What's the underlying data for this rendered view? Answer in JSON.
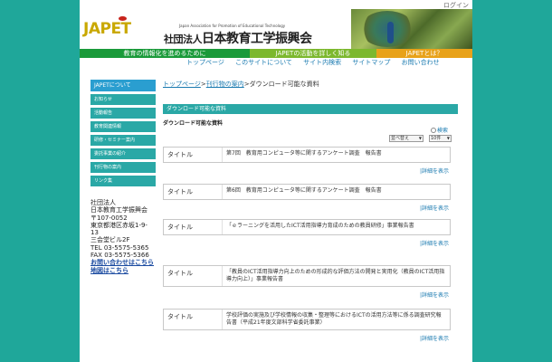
{
  "login": "ログイン",
  "header": {
    "logo_text": "JAPET",
    "org_en": "Japan Association for Promotion of Educational Technology",
    "org_corp": "社団法人",
    "org_jp": "日本教育工学振興会"
  },
  "band": {
    "seg1": "教育の情報化を進めるために",
    "seg2": "JAPETの活動を詳しく知る",
    "seg3": "JAPETとは？"
  },
  "topnav": [
    "トップページ",
    "このサイトについて",
    "サイト内検索",
    "サイトマップ",
    "お問い合わせ"
  ],
  "sidebar": {
    "items": [
      "JAPETについて",
      "お知らせ",
      "活動報告",
      "教育関連情報",
      "研修・セミナー案内",
      "委託事業の紹介",
      "刊行物の案内",
      "リンク集"
    ]
  },
  "address": {
    "line1": "社団法人",
    "line2": "日本教育工学振興会",
    "line3": "〒107-0052",
    "line4": "東京都港区赤坂1-9-",
    "line5": "13",
    "line6": "三会堂ビル2F",
    "line7": "TEL 03-5575-5365",
    "line8": "FAX 03-5575-5366",
    "contact_link": "お問い合わせはこちら",
    "map_link": "地図はこちら"
  },
  "breadcrumb": {
    "home": "トップページ",
    "sep1": ">",
    "publications": "刊行物の案内",
    "sep2": ">",
    "current": "ダウンロード可能な資料"
  },
  "section_bar": "ダウンロード可能な資料",
  "section_title": "ダウンロード可能な資料",
  "search_link": "検索",
  "sort_select": "並べ替え",
  "count_select": "10件",
  "items": [
    {
      "label": "タイトル",
      "title": "第7回　教育用コンピュータ等に関するアンケート調査　報告書",
      "detail": "|詳細を表示"
    },
    {
      "label": "タイトル",
      "title": "第6回　教育用コンピュータ等に関するアンケート調査　報告書",
      "detail": "|詳細を表示"
    },
    {
      "label": "タイトル",
      "title": "「ｅラーニングを活用したICT活用指導力育成のための教員研修」事業報告書",
      "detail": "|詳細を表示"
    },
    {
      "label": "タイトル",
      "title": "「教員のICT活用指導力向上のための形成的な評価方法の開発と実用化（教員のICT活用指導力向上）」事業報告書",
      "detail": "|詳細を表示"
    },
    {
      "label": "タイトル",
      "title": "学校評価の実施及び学校情報の収集・整理等におけるICTの活用方法等に係る調査研究報告書（平成21年度文部科学省委託事業）",
      "detail": "|詳細を表示"
    }
  ]
}
